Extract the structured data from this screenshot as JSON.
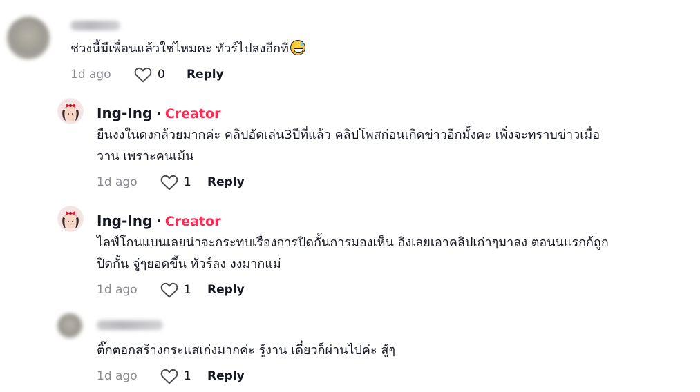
{
  "comments": [
    {
      "author": "",
      "author_blurred": true,
      "text": "ช่วงนี้มีเพื่อนแล้วใช่ไหมคะ ทัวร์ไปลงอีกที่",
      "emoji": "grinning-sweat-emoji",
      "date": "1d ago",
      "likes": "0",
      "reply_label": "Reply"
    },
    {
      "author": "Ing-Ing",
      "separator": "·",
      "badge": "Creator",
      "text_lines": [
        "ยืนงงในดงกล้วยมากค่ะ คลิปอัดเล่น3ปีที่แล้ว คลิปโพสก่อนเกิดข่าวอีกมั้งคะ เพิ่งจะทราบข่าวเมื่อ",
        "วาน เพราะคนเม้น"
      ],
      "date": "1d ago",
      "likes": "1",
      "reply_label": "Reply"
    },
    {
      "author": "Ing-Ing",
      "separator": "·",
      "badge": "Creator",
      "text_lines": [
        "ไลฟ์โกนแบนเลยน่าจะกระทบเรื่องการปิดกั้นการมองเห็น อิงเลยเอาคลิปเก่าๆมาลง ตอนนแรกก้ถูก",
        "ปิดกั้น จู่ๆยอดขึ้น ทัวร์ลง งงมากแม่"
      ],
      "date": "1d ago",
      "likes": "1",
      "reply_label": "Reply"
    },
    {
      "author": "",
      "author_blurred": true,
      "text": "ติ๊กตอกสร้างกระแสเก่งมากค่ะ รู้งาน เดี๋ยวก็ผ่านไปค่ะ สู้ๆ",
      "date": "1d ago",
      "likes": "1",
      "reply_label": "Reply"
    }
  ],
  "icons": {
    "like": "heart-outline-icon"
  },
  "colors": {
    "creator_badge": "#fe2c55",
    "meta_gray": "#8a8b91",
    "text": "#161823"
  }
}
